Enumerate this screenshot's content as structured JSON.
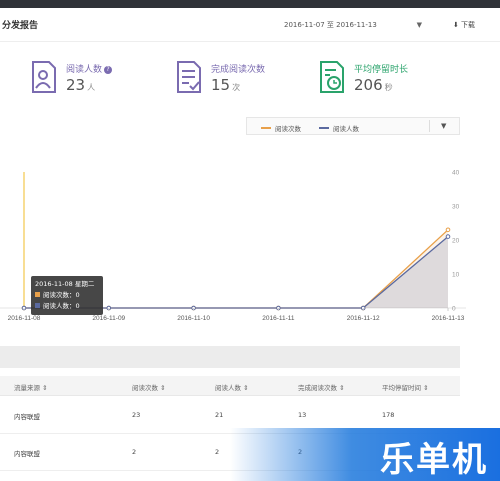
{
  "header": {
    "title": "分发报告",
    "date_range": "2016-11-07 至 2016-11-13",
    "download_label": "下载"
  },
  "stats": [
    {
      "label": "阅读人数",
      "value": "23",
      "unit": "人",
      "color": "#7a6bb0",
      "icon": "person-document-icon"
    },
    {
      "label": "完成阅读次数",
      "value": "15",
      "unit": "次",
      "color": "#7a6bb0",
      "icon": "checklist-document-icon"
    },
    {
      "label": "平均停留时长",
      "value": "206",
      "unit": "秒",
      "color": "#2aa36b",
      "icon": "clock-document-icon"
    }
  ],
  "legend": {
    "series_1": "阅读次数",
    "series_2": "阅读人数",
    "color_1": "#e8a04a",
    "color_2": "#5b6aa0"
  },
  "chart_data": {
    "type": "area",
    "x": [
      "2016-11-08",
      "2016-11-09",
      "2016-11-10",
      "2016-11-11",
      "2016-11-12",
      "2016-11-13"
    ],
    "x_labels": [
      "2016-11-08",
      "2016-11-09",
      "2016-11-10",
      "2016-11-11",
      "2016-11-12",
      "2016-11-13"
    ],
    "series": [
      {
        "name": "阅读次数",
        "values": [
          0,
          0,
          0,
          0,
          0,
          23
        ],
        "color": "#e8a04a"
      },
      {
        "name": "阅读人数",
        "values": [
          0,
          0,
          0,
          0,
          0,
          21
        ],
        "color": "#5b6aa0"
      }
    ],
    "y_ticks": [
      "40",
      "30",
      "20",
      "10",
      "0"
    ],
    "ylim": [
      0,
      40
    ]
  },
  "tooltip": {
    "title": "2016-11-08 星期二",
    "line1": "阅读次数：0",
    "line2": "阅读人数：0"
  },
  "table": {
    "headers": [
      "流量来源",
      "阅读次数",
      "阅读人数",
      "完成阅读次数",
      "平均停留时间"
    ],
    "rows": [
      [
        "内容联盟",
        "23",
        "21",
        "13",
        "178"
      ],
      [
        "内容联盟",
        "2",
        "2",
        "2",
        ""
      ]
    ]
  },
  "watermark": "乐单机"
}
